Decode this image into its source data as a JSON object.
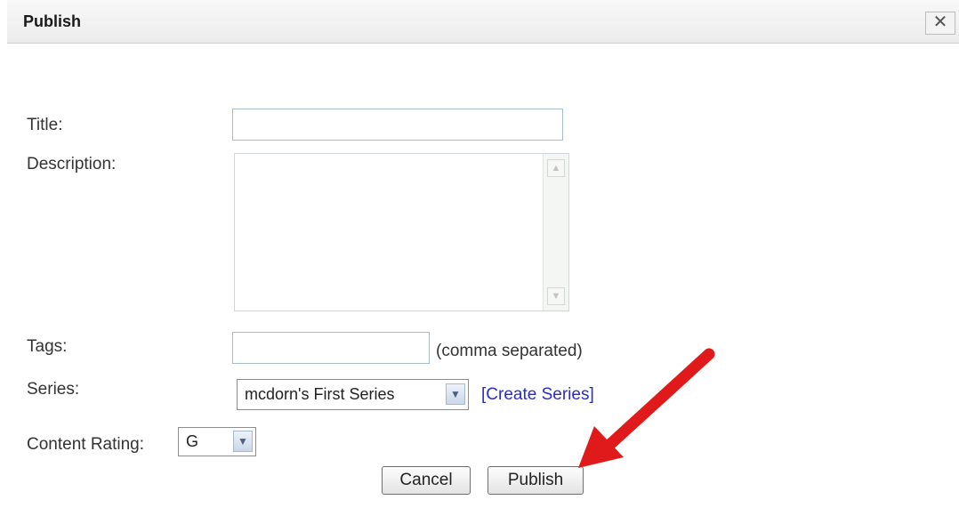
{
  "dialog": {
    "title": "Publish",
    "close_icon": "close-icon",
    "close_glyph": "✕"
  },
  "form": {
    "title_label": "Title:",
    "title_value": "",
    "description_label": "Description:",
    "description_value": "",
    "tags_label": "Tags:",
    "tags_value": "",
    "tags_hint": "(comma separated)",
    "series_label": "Series:",
    "series_selected": "mcdorn's First Series",
    "create_series_link": "[Create Series]",
    "rating_label": "Content Rating:",
    "rating_selected": "G"
  },
  "buttons": {
    "cancel": "Cancel",
    "publish": "Publish"
  },
  "annotation": {
    "icon": "red-arrow-icon",
    "color": "#e01a1a"
  },
  "colors": {
    "link": "#2a2ad0",
    "input_border": "#a7bccd"
  }
}
